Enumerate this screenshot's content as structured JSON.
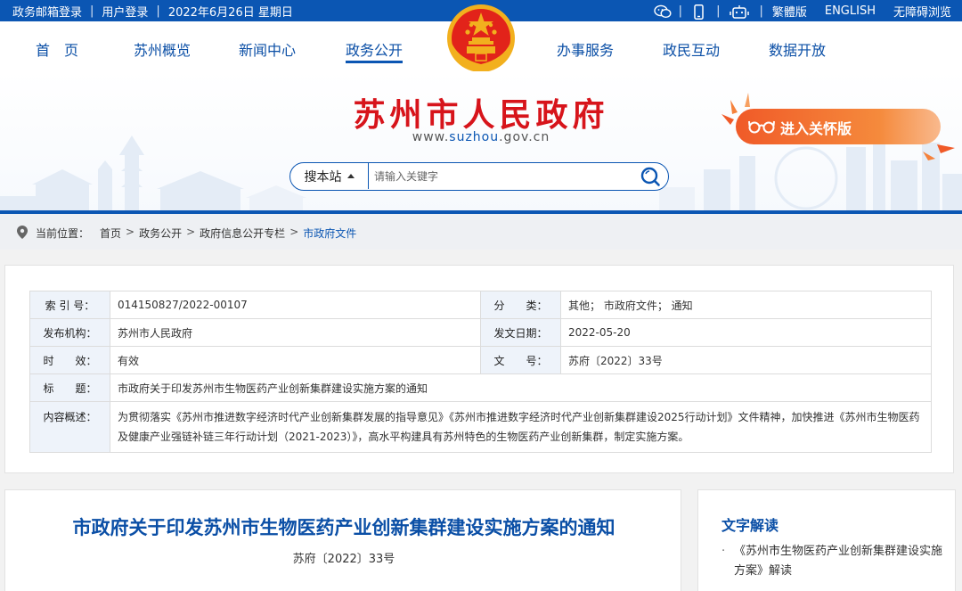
{
  "topbar": {
    "left_links": [
      "政务邮箱登录",
      "用户登录"
    ],
    "date": "2022年6月26日 星期日",
    "right_links": [
      "繁體版",
      "ENGLISH",
      "无障碍浏览"
    ],
    "icons": [
      "wechat-icon",
      "mobile-icon",
      "robot-icon"
    ]
  },
  "nav": {
    "items": [
      "首　页",
      "苏州概览",
      "新闻中心",
      "政务公开",
      "办事服务",
      "政民互动",
      "数据开放"
    ],
    "active": "政务公开"
  },
  "header": {
    "title": "苏州市人民政府",
    "url_prefix": "www.",
    "url_highlight": "suzhou",
    "url_suffix": ".gov.cn",
    "care_label": "进入关怀版"
  },
  "search": {
    "scope": "搜本站",
    "placeholder": "请输入关键字"
  },
  "breadcrumb": {
    "label": "当前位置：",
    "items": [
      "首页",
      "政务公开",
      "政府信息公开专栏",
      "市政府文件"
    ],
    "separator": ">"
  },
  "meta": {
    "index_label": "索 引 号：",
    "index_value": "014150827/2022-00107",
    "category_label": "分　　类：",
    "category_value": "其他；  市政府文件；  通知",
    "publisher_label": "发布机构：",
    "publisher_value": "苏州市人民政府",
    "date_label": "发文日期：",
    "date_value": "2022-05-20",
    "validity_label": "时　　效：",
    "validity_value": "有效",
    "docno_label": "文　　号：",
    "docno_value": "苏府〔2022〕33号",
    "title_label": "标　　题：",
    "title_value": "市政府关于印发苏州市生物医药产业创新集群建设实施方案的通知",
    "summary_label": "内容概述：",
    "summary_value": "为贯彻落实《苏州市推进数字经济时代产业创新集群发展的指导意见》《苏州市推进数字经济时代产业创新集群建设2025行动计划》文件精神，加快推进《苏州市生物医药及健康产业强链补链三年行动计划（2021-2023）》，高水平构建具有苏州特色的生物医药产业创新集群，制定实施方案。"
  },
  "article": {
    "title": "市政府关于印发苏州市生物医药产业创新集群建设实施方案的通知",
    "docno": "苏府〔2022〕33号"
  },
  "aside": {
    "heading": "文字解读",
    "bullet": "·",
    "item": "《苏州市生物医药产业创新集群建设实施方案》解读"
  },
  "colors": {
    "primary_blue": "#0b56b3",
    "title_red": "#d7141b",
    "care_orange": "#f05a28"
  }
}
